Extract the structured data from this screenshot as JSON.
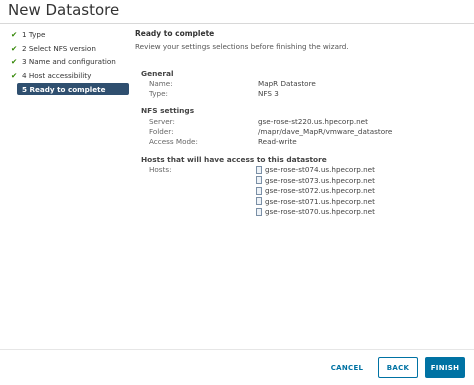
{
  "window": {
    "title": "New Datastore"
  },
  "steps": [
    {
      "label": "1 Type",
      "done": true
    },
    {
      "label": "2 Select NFS version",
      "done": true
    },
    {
      "label": "3 Name and configuration",
      "done": true
    },
    {
      "label": "4 Host accessibility",
      "done": true
    },
    {
      "label": "5 Ready to complete",
      "active": true
    }
  ],
  "check_glyph": "✔",
  "main": {
    "heading": "Ready to complete",
    "subheading": "Review your settings selections before finishing the wizard.",
    "general": {
      "title": "General",
      "rows": [
        {
          "label": "Name:",
          "value": "MapR Datastore"
        },
        {
          "label": "Type:",
          "value": "NFS 3"
        }
      ]
    },
    "nfs": {
      "title": "NFS settings",
      "rows": [
        {
          "label": "Server:",
          "value": "gse-rose-st220.us.hpecorp.net"
        },
        {
          "label": "Folder:",
          "value": "/mapr/dave_MapR/vmware_datastore"
        },
        {
          "label": "Access Mode:",
          "value": "Read-write"
        }
      ]
    },
    "hosts": {
      "title": "Hosts that will have access to this datastore",
      "label": "Hosts:",
      "items": [
        "gse-rose-st074.us.hpecorp.net",
        "gse-rose-st073.us.hpecorp.net",
        "gse-rose-st072.us.hpecorp.net",
        "gse-rose-st071.us.hpecorp.net",
        "gse-rose-st070.us.hpecorp.net"
      ],
      "icon": "host-icon"
    }
  },
  "footer": {
    "cancel_label": "CANCEL",
    "back_label": "BACK",
    "finish_label": "FINISH"
  },
  "colors": {
    "accent": "#0072a3",
    "active_step_bg": "#2f4f6f",
    "check": "#2f8400"
  }
}
